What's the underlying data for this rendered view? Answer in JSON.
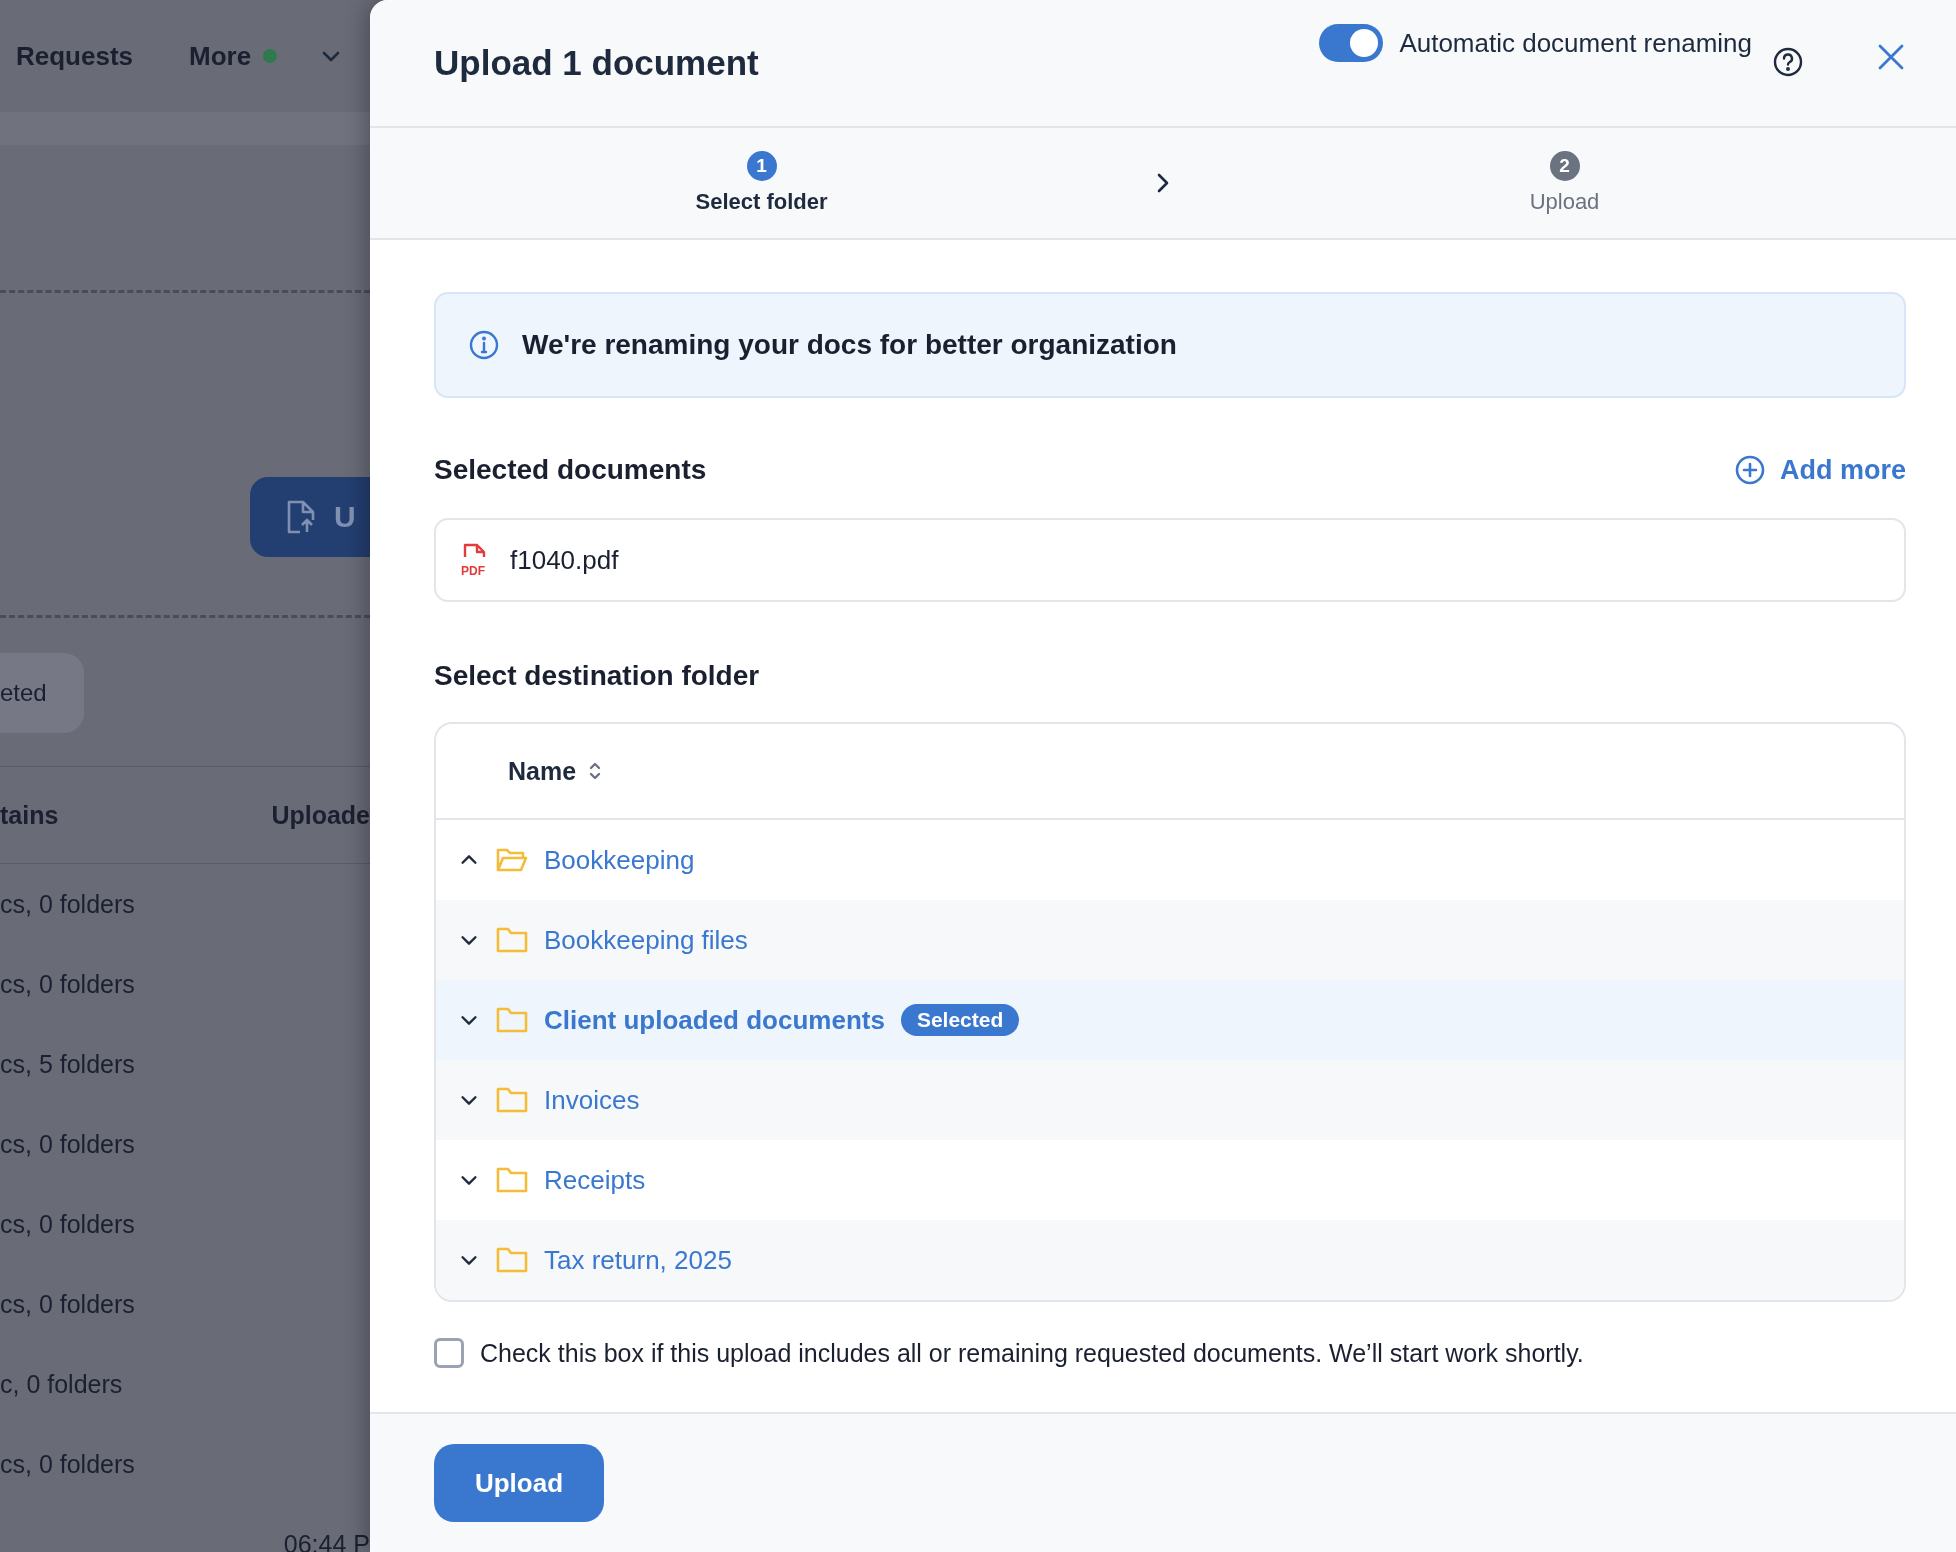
{
  "background_page": {
    "nav": [
      {
        "label": "Requests"
      },
      {
        "label": "More"
      }
    ],
    "upload_button": "U",
    "filter_chip": "eted",
    "table": {
      "columns": [
        "tains",
        "Uploade"
      ],
      "rows": [
        {
          "column_1": "cs, 0 folders"
        },
        {
          "column_1": "cs, 0 folders"
        },
        {
          "column_1": "cs, 5 folders"
        },
        {
          "column_1": "cs, 0 folders"
        },
        {
          "column_1": "cs, 0 folders"
        },
        {
          "column_1": "cs, 0 folders"
        },
        {
          "column_1": "c, 0 folders"
        },
        {
          "column_1": "cs, 0 folders"
        },
        {
          "column_2": "06:44 P"
        }
      ]
    }
  },
  "dialog": {
    "title": "Upload 1 document",
    "auto_rename": {
      "label": "Automatic document renaming",
      "on": true
    },
    "steps": [
      {
        "number": "1",
        "label": "Select folder",
        "selected": true
      },
      {
        "number": "2",
        "label": "Upload",
        "selected": false
      }
    ],
    "info_banner": "We're renaming your docs for better organization",
    "selected_documents": {
      "heading": "Selected documents",
      "add_more": "Add more",
      "files": [
        {
          "name": "f1040.pdf",
          "type_label": "PDF"
        }
      ]
    },
    "destination": {
      "heading": "Select destination folder",
      "column": "Name",
      "folders": [
        {
          "name": "Bookkeeping",
          "expanded": true,
          "selected": false
        },
        {
          "name": "Bookkeeping files",
          "expanded": false,
          "selected": false
        },
        {
          "name": "Client uploaded documents",
          "expanded": false,
          "selected": true,
          "badge": "Selected"
        },
        {
          "name": "Invoices",
          "expanded": false,
          "selected": false
        },
        {
          "name": "Receipts",
          "expanded": false,
          "selected": false
        },
        {
          "name": "Tax return, 2025",
          "expanded": false,
          "selected": false
        }
      ]
    },
    "confirm_checkbox": {
      "label": "Check this box if this upload includes all or remaining requested documents. We’ll start work shortly.",
      "checked": false
    },
    "footer": {
      "upload_button": "Upload"
    }
  }
}
